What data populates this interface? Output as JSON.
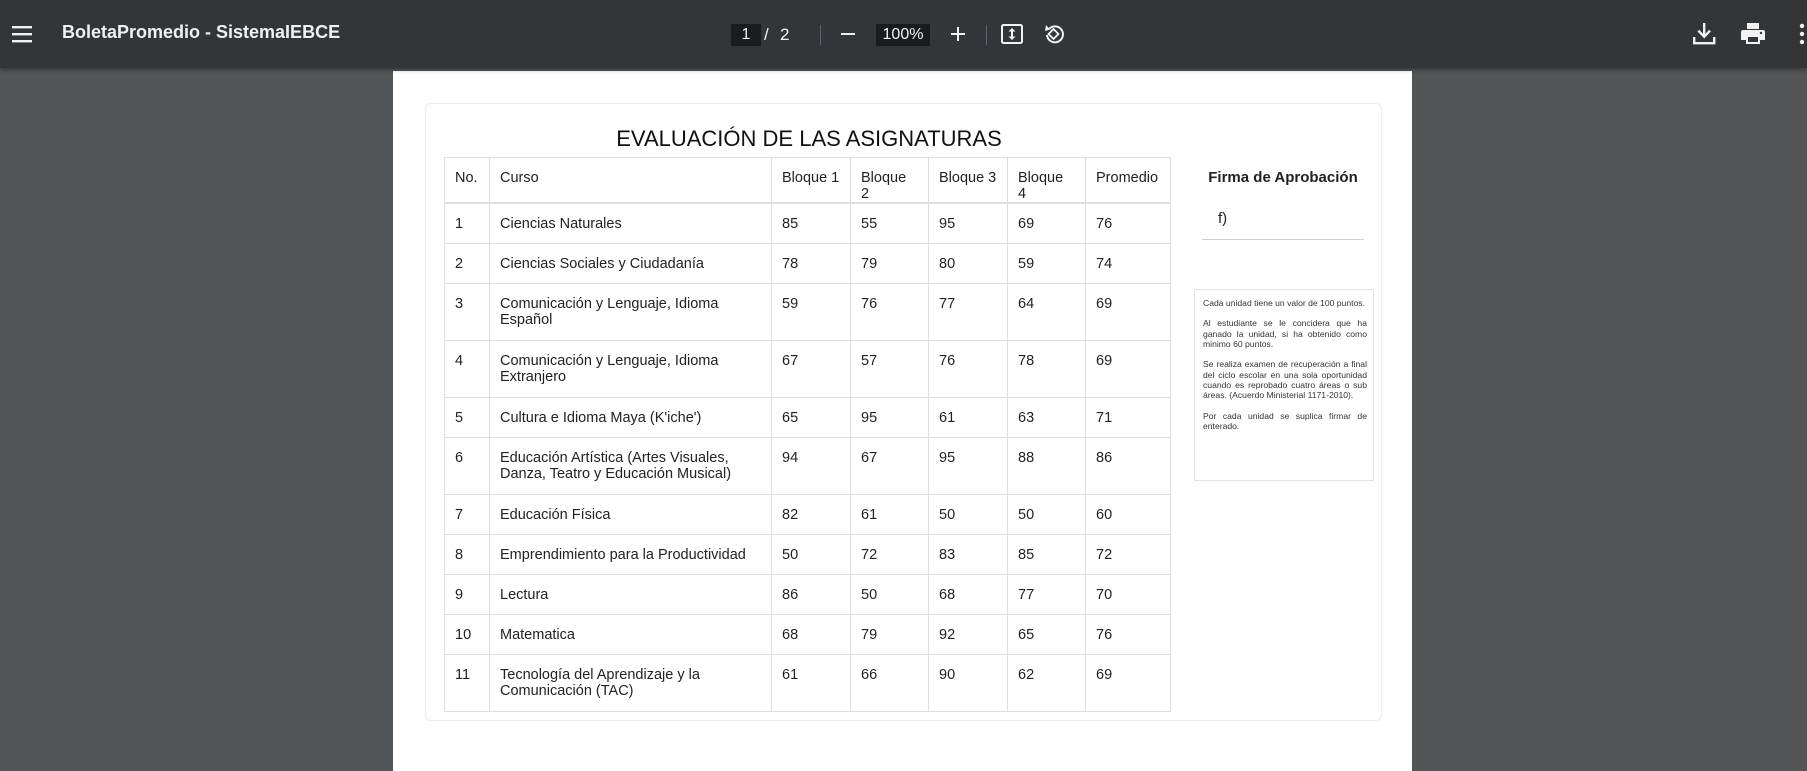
{
  "toolbar": {
    "title": "BoletaPromedio - SistemaIEBCE",
    "page_current": "1",
    "page_separator": "/",
    "page_total": "2",
    "zoom": "100%",
    "icons": [
      "menu-icon",
      "minus-icon",
      "plus-icon",
      "fit-page-icon",
      "rotate-icon",
      "download-icon",
      "print-icon",
      "more-icon"
    ]
  },
  "document": {
    "title": "EVALUACIÓN DE LAS ASIGNATURAS",
    "table": {
      "headers": [
        "No.",
        "Curso",
        "Bloque 1",
        "Bloque 2",
        "Bloque 3",
        "Bloque 4",
        "Promedio"
      ],
      "rows": [
        {
          "no": "1",
          "curso": "Ciencias Naturales",
          "b1": "85",
          "b2": "55",
          "b3": "95",
          "b4": "69",
          "promedio": "76"
        },
        {
          "no": "2",
          "curso": "Ciencias Sociales y Ciudadanía",
          "b1": "78",
          "b2": "79",
          "b3": "80",
          "b4": "59",
          "promedio": "74"
        },
        {
          "no": "3",
          "curso": "Comunicación y Lenguaje, Idioma Español",
          "b1": "59",
          "b2": "76",
          "b3": "77",
          "b4": "64",
          "promedio": "69"
        },
        {
          "no": "4",
          "curso": "Comunicación y Lenguaje, Idioma Extranjero",
          "b1": "67",
          "b2": "57",
          "b3": "76",
          "b4": "78",
          "promedio": "69"
        },
        {
          "no": "5",
          "curso": "Cultura e Idioma Maya (K'iche')",
          "b1": "65",
          "b2": "95",
          "b3": "61",
          "b4": "63",
          "promedio": "71"
        },
        {
          "no": "6",
          "curso": "Educación Artística (Artes Visuales, Danza, Teatro y Educación Musical)",
          "b1": "94",
          "b2": "67",
          "b3": "95",
          "b4": "88",
          "promedio": "86"
        },
        {
          "no": "7",
          "curso": "Educación Física",
          "b1": "82",
          "b2": "61",
          "b3": "50",
          "b4": "50",
          "promedio": "60"
        },
        {
          "no": "8",
          "curso": "Emprendimiento para la Productividad",
          "b1": "50",
          "b2": "72",
          "b3": "83",
          "b4": "85",
          "promedio": "72"
        },
        {
          "no": "9",
          "curso": "Lectura",
          "b1": "86",
          "b2": "50",
          "b3": "68",
          "b4": "77",
          "promedio": "70"
        },
        {
          "no": "10",
          "curso": "Matematica",
          "b1": "68",
          "b2": "79",
          "b3": "92",
          "b4": "65",
          "promedio": "76"
        },
        {
          "no": "11",
          "curso": "Tecnología del Aprendizaje y la Comunicación (TAC)",
          "b1": "61",
          "b2": "66",
          "b3": "90",
          "b4": "62",
          "promedio": "69"
        }
      ]
    },
    "approval": {
      "title": "Firma de Aprobación",
      "signature_prefix": "f)"
    },
    "notes": [
      "Cada unidad tiene un valor de 100 puntos.",
      "Al estudiante se le concidera que ha ganado la unidad, si ha obtenido como minimo 60 puntos.",
      "Se realiza examen de recuperación a final del ciclo escolar en una sola oportunidad cuando es reprobado cuatro áreas o sub áreas. (Acuerdo Ministerial 1171-2010).",
      "Por cada unidad se suplica firmar de enterado."
    ]
  }
}
